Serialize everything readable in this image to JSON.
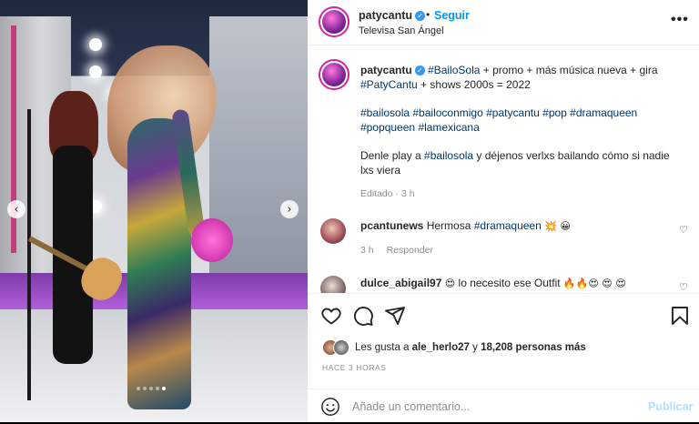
{
  "header": {
    "username": "patycantu",
    "separator": "•",
    "follow_label": "Seguir",
    "location": "Televisa San Ángel",
    "more_label": "•••"
  },
  "caption": {
    "username": "patycantu",
    "line1_tag1": "#BailoSola",
    "line1_rest": " + promo + más música nueva + gira ",
    "line1_tag2": "#PatyCantu",
    "line1_end": " + shows 2000s = 2022",
    "hashtags": "#bailosola #bailoconmigo #patycantu #pop #dramaqueen #popqueen #lamexicana",
    "line3_start": "Denle play a ",
    "line3_tag": "#bailosola",
    "line3_end": " y déjenos verlxs bailando cómo si nadie lxs viera",
    "meta": "Editado · 3 h"
  },
  "comments": [
    {
      "username": "pcantunews",
      "text": "Hermosa ",
      "tag": "#dramaqueen",
      "emoji": " 💥 😀",
      "time": "3 h",
      "reply_label": "Responder"
    },
    {
      "username": "dulce_abigail97",
      "emoji_pre": "😍",
      "text": " lo necesito ese Outfit ",
      "emoji_post": "🔥🔥😍 😍 😍"
    }
  ],
  "likes": {
    "prefix": "Les gusta a ",
    "user": "ale_herlo27",
    "middle": " y ",
    "count": "18,208 personas más"
  },
  "timestamp": "HACE 3 HORAS",
  "comment_box": {
    "placeholder": "Añade un comentario...",
    "publish_label": "Publicar"
  },
  "media": {
    "prev_label": "‹",
    "next_label": "›",
    "slide_count": 5,
    "active_slide": 4
  },
  "colors": {
    "accent": "#0095f6",
    "link": "#00376b",
    "muted": "#8e8e8e",
    "publish_disabled": "#b2dffc"
  },
  "icons": [
    "heart-icon",
    "comment-icon",
    "share-icon",
    "bookmark-icon",
    "smile-icon",
    "verified-icon",
    "more-icon"
  ]
}
